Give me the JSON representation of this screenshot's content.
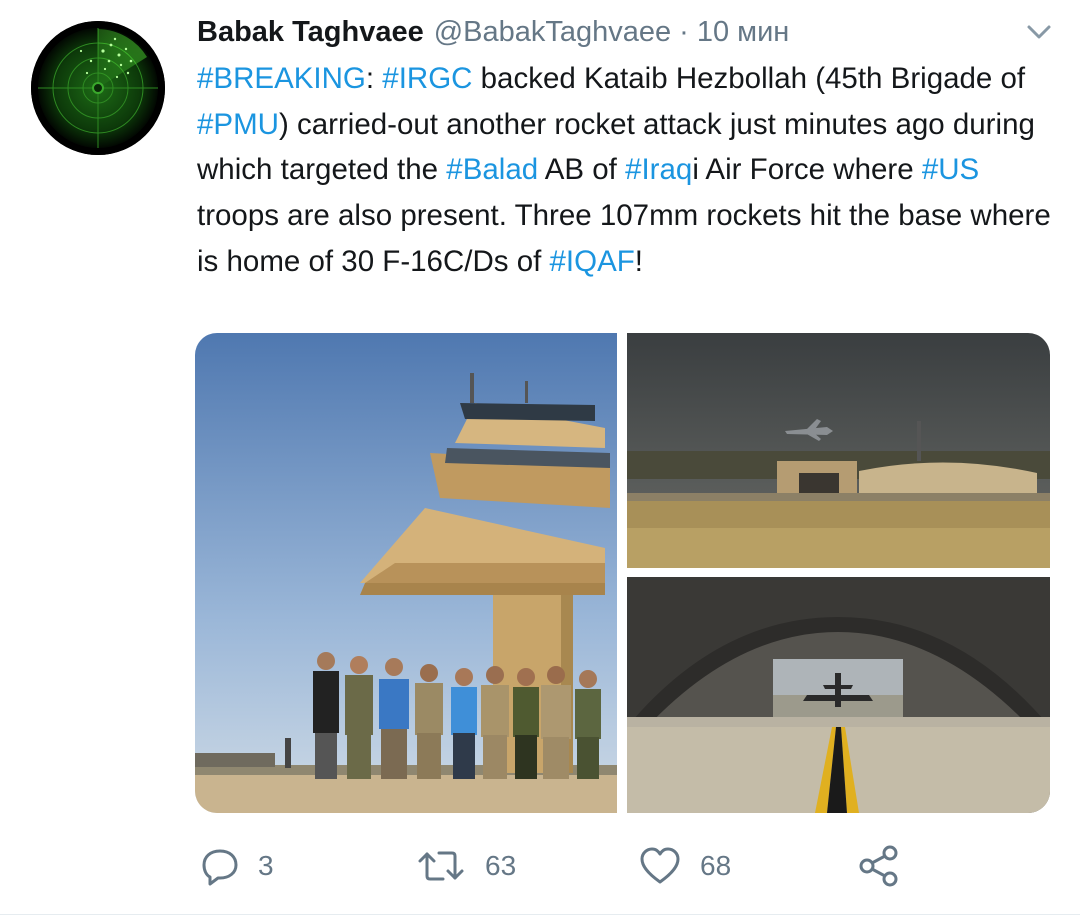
{
  "tweet": {
    "author_name": "Babak Taghvaee",
    "handle": "@BabakTaghvaee",
    "separator": "·",
    "time": "10 мин",
    "text_segments": [
      {
        "text": "#BREAKING",
        "tag": true
      },
      {
        "text": ": ",
        "tag": false
      },
      {
        "text": "#IRGC",
        "tag": true
      },
      {
        "text": " backed Kataib Hezbollah (45th Brigade of ",
        "tag": false
      },
      {
        "text": "#PMU",
        "tag": true
      },
      {
        "text": ") carried-out another rocket attack just minutes ago during which targeted the ",
        "tag": false
      },
      {
        "text": "#Balad",
        "tag": true
      },
      {
        "text": " AB of ",
        "tag": false
      },
      {
        "text": "#Iraq",
        "tag": true
      },
      {
        "text": "i Air Force where ",
        "tag": false
      },
      {
        "text": "#US",
        "tag": true
      },
      {
        "text": " troops are also present. Three 107mm rockets hit the base where is home of 30 F-16C/Ds of ",
        "tag": false
      },
      {
        "text": "#IQAF",
        "tag": true
      },
      {
        "text": "!",
        "tag": false
      }
    ]
  },
  "actions": {
    "reply_count": "3",
    "retweet_count": "63",
    "like_count": "68"
  },
  "icons": {
    "reply": "reply-icon",
    "retweet": "retweet-icon",
    "like": "heart-icon",
    "share": "share-icon",
    "more": "chevron-down-icon"
  },
  "colors": {
    "link": "#1b95e0",
    "secondary": "#657786",
    "text": "#14171a"
  }
}
